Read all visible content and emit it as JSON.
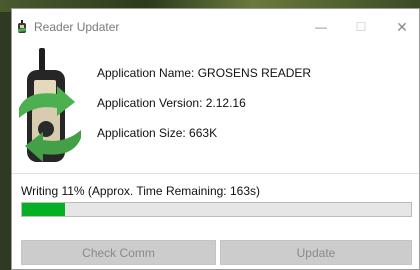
{
  "window": {
    "title": "Reader Updater",
    "controls": {
      "minimize": "—",
      "maximize": "☐",
      "close": "✕"
    }
  },
  "app": {
    "name_line": "Application Name: GROSENS READER",
    "version_line": "Application Version: 2.12.16",
    "size_line": "Application Size: 663K"
  },
  "progress": {
    "status_text": "Writing 11% (Approx. Time Remaining: 163s)",
    "fraction": 0.11,
    "fill_color": "#06b025"
  },
  "buttons": {
    "check_comm": "Check Comm",
    "update": "Update"
  },
  "icons": {
    "title": "reader-device-icon",
    "art": "reader-device-sync-icon"
  }
}
